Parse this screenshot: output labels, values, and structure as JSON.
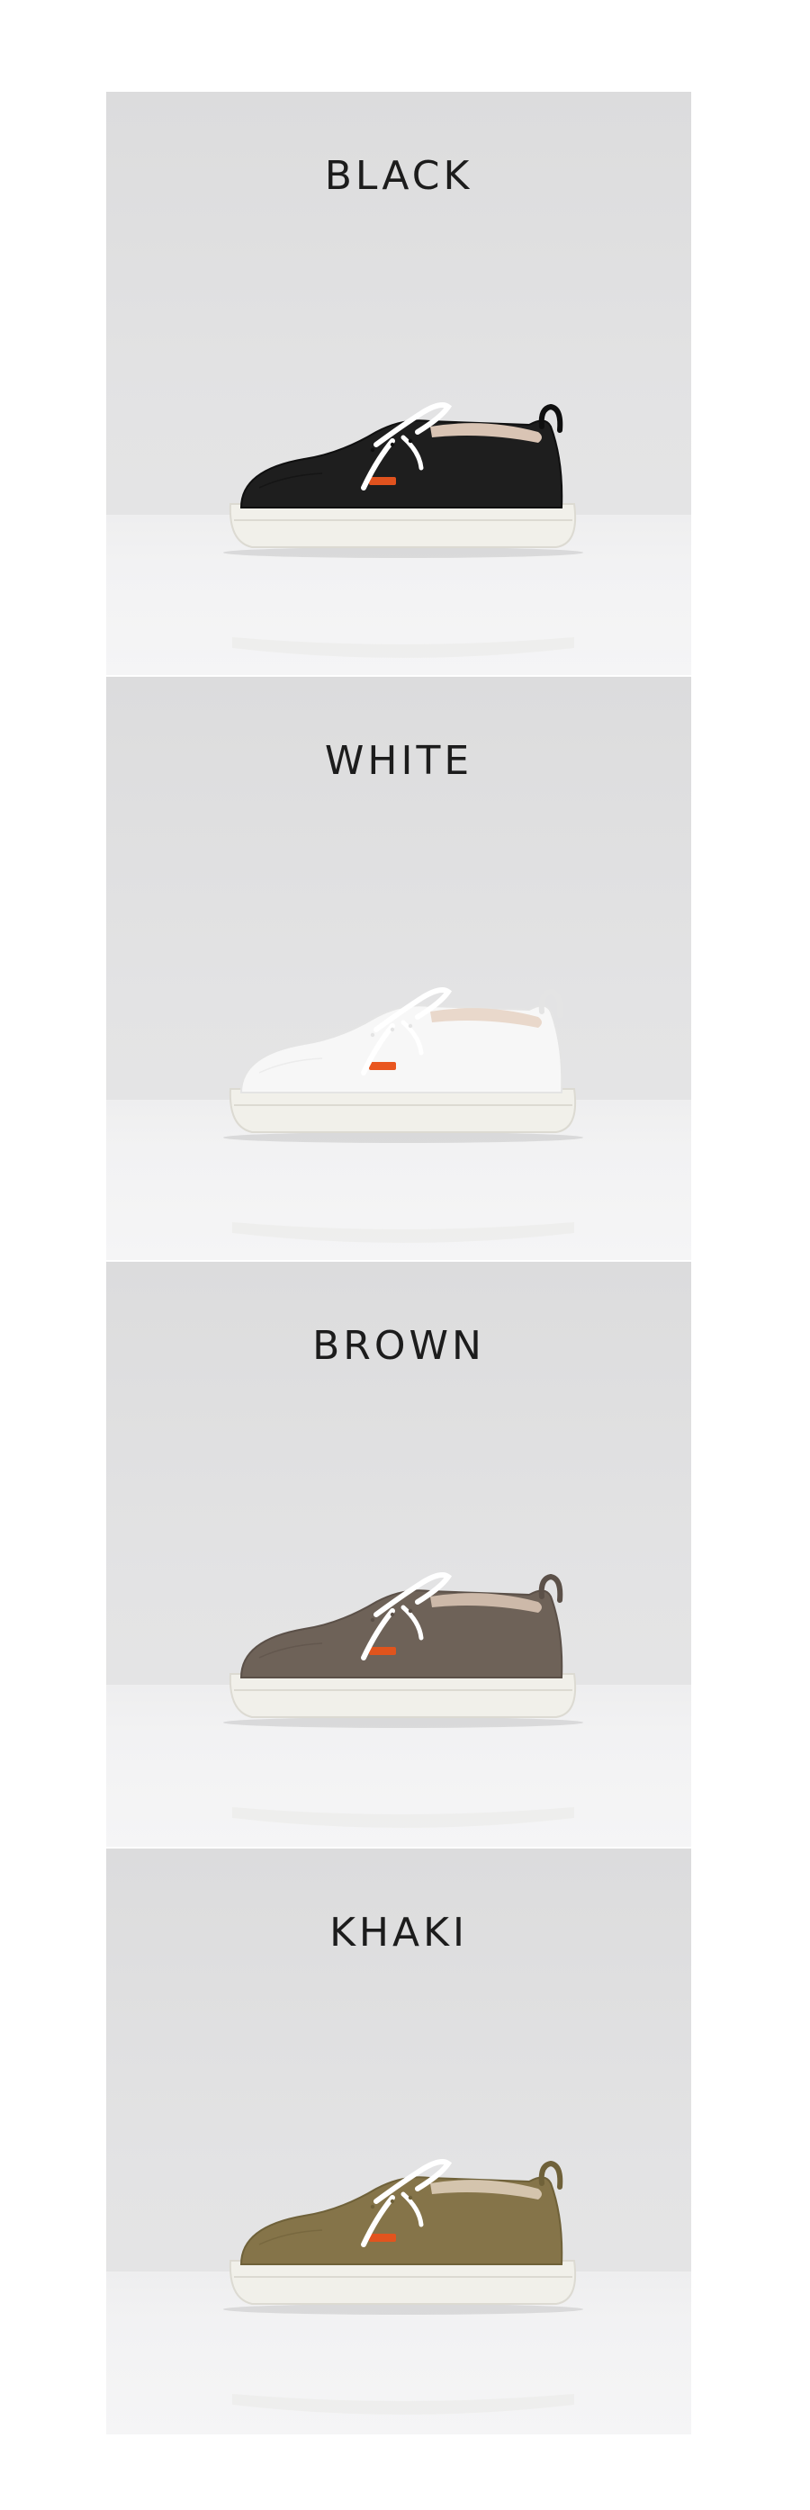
{
  "variants": [
    {
      "name": "BLACK",
      "upper": "#1e1e1e",
      "upper_shade": "#0f0f0f",
      "lining": "#d9c4b4",
      "tab": "#e0521e"
    },
    {
      "name": "WHITE",
      "upper": "#f7f7f7",
      "upper_shade": "#e4e4e4",
      "lining": "#e9d8cb",
      "tab": "#e9561f"
    },
    {
      "name": "BROWN",
      "upper": "#6e6258",
      "upper_shade": "#5b5048",
      "lining": "#cdb9a9",
      "tab": "#e0541d"
    },
    {
      "name": "KHAKI",
      "upper": "#857449",
      "upper_shade": "#6f6139",
      "lining": "#d4c4ad",
      "tab": "#e2541e"
    }
  ],
  "colors": {
    "sole": "#f1f0ea",
    "sole_edge": "#dcdad2",
    "laces": "#ffffff"
  }
}
